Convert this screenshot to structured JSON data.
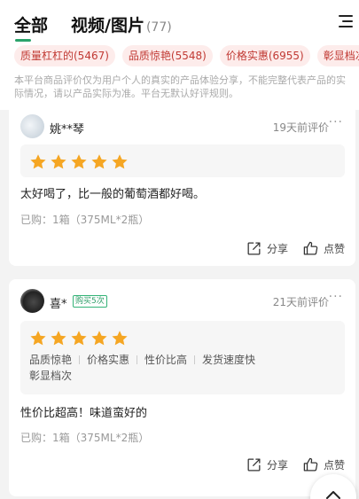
{
  "tabs": {
    "all_label": "全部",
    "media_label": "视频/图片",
    "media_count": "(77)"
  },
  "filter_chips": [
    {
      "label": "质量杠杠的(5467)"
    },
    {
      "label": "品质惊艳(5548)"
    },
    {
      "label": "价格实惠(6955)"
    },
    {
      "label": "彰显档次"
    }
  ],
  "notice": "本平台商品评价仅为用户个人的真实的产品体验分享，不能完整代表产品的实际情况，请以产品实际为准。平台无默认好评规则。",
  "reviews": [
    {
      "user": "姚**琴",
      "badge": "",
      "time": "19天前评价",
      "more": "···",
      "stars": 5,
      "tags": [],
      "content": "太好喝了，比一般的葡萄酒都好喝。",
      "purchase": "已购：1箱（375ML*2瓶）",
      "share_label": "分享",
      "like_label": "点赞"
    },
    {
      "user": "喜*",
      "badge": "购买5次",
      "time": "21天前评价",
      "more": "···",
      "stars": 5,
      "tags": [
        "品质惊艳",
        "价格实惠",
        "性价比高",
        "发货速度快",
        "彰显档次"
      ],
      "content": "性价比超高！味道蛮好的",
      "purchase": "已购：1箱（375ML*2瓶）",
      "share_label": "分享",
      "like_label": "点赞"
    }
  ],
  "colors": {
    "accent_green": "#2aa36b",
    "chip_bg": "#fdeceb",
    "chip_text": "#c13a34",
    "star": "#f5a623"
  },
  "icons": {
    "menu": "hamburger-menu-icon",
    "share": "share-icon",
    "like": "thumbs-up-icon",
    "back_to_top": "chevron-up-icon"
  }
}
